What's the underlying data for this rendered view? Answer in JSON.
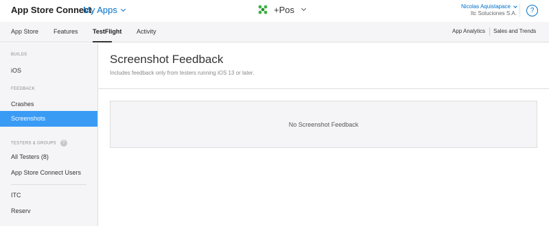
{
  "topbar": {
    "brand": "App Store Connect",
    "apps_menu": "My Apps",
    "app_name": "+Pos",
    "account_name": "Nicolas Aquistapace",
    "account_org": "Itc Soluciones S.A.",
    "help": "?"
  },
  "subnav": {
    "tabs": [
      {
        "label": "App Store"
      },
      {
        "label": "Features"
      },
      {
        "label": "TestFlight"
      },
      {
        "label": "Activity"
      }
    ],
    "active_tab": "TestFlight",
    "right_links": [
      {
        "label": "App Analytics"
      },
      {
        "label": "Sales and Trends"
      }
    ]
  },
  "sidebar": {
    "builds_title": "BUILDS",
    "builds_items": [
      {
        "label": "iOS"
      }
    ],
    "feedback_title": "FEEDBACK",
    "feedback_items": [
      {
        "label": "Crashes"
      },
      {
        "label": "Screenshots"
      }
    ],
    "active_item": "Screenshots",
    "testers_title": "TESTERS & GROUPS",
    "testers_help": "?",
    "testers_items": [
      {
        "label": "All Testers (8)"
      },
      {
        "label": "App Store Connect Users"
      }
    ],
    "groups_items": [
      {
        "label": "ITC"
      },
      {
        "label": "Reserv"
      }
    ]
  },
  "main": {
    "title": "Screenshot Feedback",
    "subtitle": "Includes feedback only from testers running iOS 13 or later.",
    "empty_message": "No Screenshot Feedback"
  },
  "colors": {
    "accent": "#0070c9",
    "sidebar_active": "#3a9bf5",
    "app_icon": "#3cb043"
  }
}
